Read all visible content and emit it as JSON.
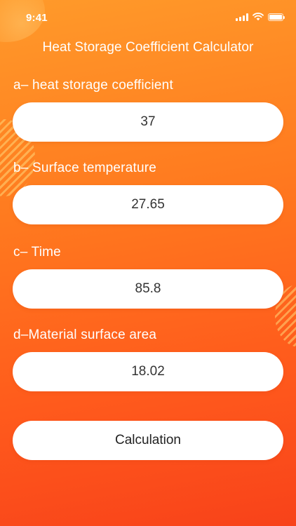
{
  "status_bar": {
    "time": "9:41",
    "icons": [
      "signal-icon",
      "wifi-icon",
      "battery-icon"
    ]
  },
  "app": {
    "title": "Heat Storage Coefficient Calculator"
  },
  "fields": [
    {
      "label": "a– heat storage coefficient",
      "value": "37"
    },
    {
      "label": "b– Surface temperature",
      "value": "27.65"
    },
    {
      "label": "c– Time",
      "value": "85.8"
    },
    {
      "label": "d–Material surface area",
      "value": "18.02"
    }
  ],
  "actions": {
    "calculate_label": "Calculation"
  },
  "colors": {
    "background_top": "#ff9a2a",
    "background_bottom": "#f8421a",
    "input_background": "#ffffff",
    "input_text": "#333333",
    "label_text": "#ffffff"
  }
}
